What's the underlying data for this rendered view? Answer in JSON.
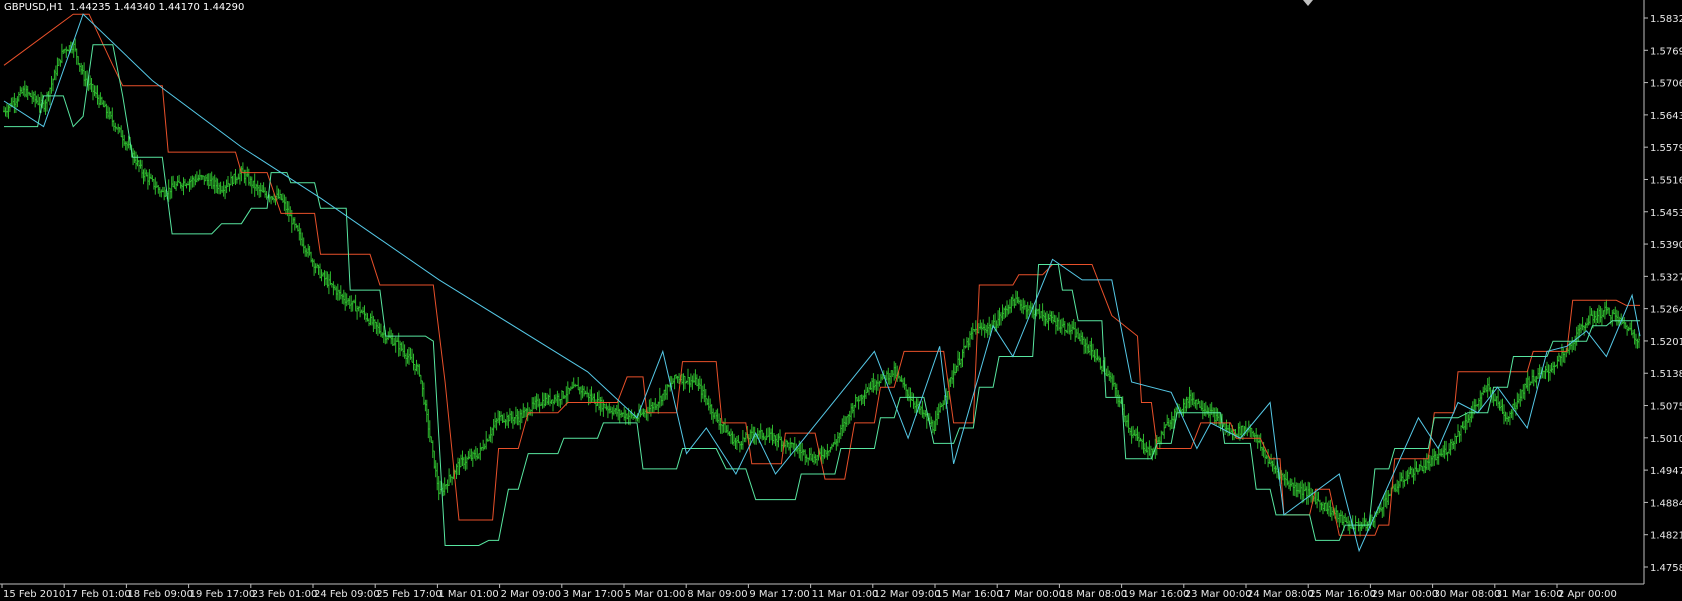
{
  "window": {
    "symbol_timeframe": "GBPUSD,H1",
    "ohlc": "1.44235 1.44340 1.44170 1.44290"
  },
  "colors": {
    "background": "#000000",
    "bars": "#2eb82e",
    "upper_channel": "#e8502a",
    "lower_channel": "#58e6a0",
    "zigzag": "#55c8e6",
    "axis_text": "#e8e8e8",
    "axis_line": "#bfbfbf"
  },
  "chart_data": {
    "type": "line",
    "title": "GBPUSD,H1",
    "price_axis_labels": [
      "1.58325",
      "1.57695",
      "1.57065",
      "1.56435",
      "1.55790",
      "1.55160",
      "1.54530",
      "1.53900",
      "1.53270",
      "1.52640",
      "1.52010",
      "1.51380",
      "1.50755",
      "1.50105",
      "1.49475",
      "1.48845",
      "1.48215",
      "1.47580"
    ],
    "time_axis_labels": [
      "15 Feb 2010",
      "17 Feb 01:00",
      "18 Feb 09:00",
      "19 Feb 17:00",
      "23 Feb 01:00",
      "24 Feb 09:00",
      "25 Feb 17:00",
      "1 Mar 01:00",
      "2 Mar 09:00",
      "3 Mar 17:00",
      "5 Mar 01:00",
      "8 Mar 09:00",
      "9 Mar 17:00",
      "11 Mar 01:00",
      "12 Mar 09:00",
      "15 Mar 16:00",
      "17 Mar 00:00",
      "18 Mar 08:00",
      "19 Mar 16:00",
      "23 Mar 00:00",
      "24 Mar 08:00",
      "25 Mar 16:00",
      "29 Mar 00:00",
      "30 Mar 08:00",
      "31 Mar 16:00",
      "2 Apr 00:00"
    ],
    "ylim": [
      1.4758,
      1.5865
    ],
    "close_path": [
      [
        0,
        1.565
      ],
      [
        1,
        1.569
      ],
      [
        2,
        1.566
      ],
      [
        3,
        1.577
      ],
      [
        3.5,
        1.578
      ],
      [
        4,
        1.572
      ],
      [
        5,
        1.566
      ],
      [
        6,
        1.56
      ],
      [
        7,
        1.553
      ],
      [
        8,
        1.549
      ],
      [
        9,
        1.551
      ],
      [
        10,
        1.552
      ],
      [
        11,
        1.55
      ],
      [
        12,
        1.553
      ],
      [
        13,
        1.549
      ],
      [
        14,
        1.548
      ],
      [
        15,
        1.54
      ],
      [
        16,
        1.533
      ],
      [
        17,
        1.529
      ],
      [
        18,
        1.526
      ],
      [
        19,
        1.522
      ],
      [
        20,
        1.519
      ],
      [
        21,
        1.514
      ],
      [
        22,
        1.49
      ],
      [
        23,
        1.496
      ],
      [
        24,
        1.498
      ],
      [
        25,
        1.505
      ],
      [
        26,
        1.505
      ],
      [
        27,
        1.508
      ],
      [
        28,
        1.509
      ],
      [
        29,
        1.511
      ],
      [
        30,
        1.508
      ],
      [
        31,
        1.506
      ],
      [
        32,
        1.505
      ],
      [
        33,
        1.508
      ],
      [
        34,
        1.513
      ],
      [
        35,
        1.512
      ],
      [
        36,
        1.505
      ],
      [
        37,
        1.5
      ],
      [
        38,
        1.502
      ],
      [
        39,
        1.501
      ],
      [
        40,
        1.499
      ],
      [
        41,
        1.497
      ],
      [
        42,
        1.5
      ],
      [
        43,
        1.508
      ],
      [
        44,
        1.512
      ],
      [
        45,
        1.514
      ],
      [
        46,
        1.508
      ],
      [
        47,
        1.503
      ],
      [
        48,
        1.514
      ],
      [
        49,
        1.522
      ],
      [
        50,
        1.523
      ],
      [
        51,
        1.528
      ],
      [
        52,
        1.526
      ],
      [
        53,
        1.524
      ],
      [
        54,
        1.522
      ],
      [
        55,
        1.518
      ],
      [
        56,
        1.512
      ],
      [
        57,
        1.502
      ],
      [
        58,
        1.498
      ],
      [
        59,
        1.505
      ],
      [
        60,
        1.509
      ],
      [
        61,
        1.506
      ],
      [
        62,
        1.502
      ],
      [
        63,
        1.503
      ],
      [
        64,
        1.496
      ],
      [
        65,
        1.492
      ],
      [
        66,
        1.49
      ],
      [
        67,
        1.487
      ],
      [
        68,
        1.484
      ],
      [
        69,
        1.484
      ],
      [
        70,
        1.49
      ],
      [
        71,
        1.494
      ],
      [
        72,
        1.496
      ],
      [
        73,
        1.499
      ],
      [
        74,
        1.505
      ],
      [
        75,
        1.511
      ],
      [
        76,
        1.505
      ],
      [
        77,
        1.512
      ],
      [
        78,
        1.514
      ],
      [
        79,
        1.518
      ],
      [
        80,
        1.524
      ],
      [
        81,
        1.526
      ],
      [
        82,
        1.523
      ],
      [
        82.7,
        1.52
      ]
    ],
    "upper_channel": [
      [
        0,
        1.574
      ],
      [
        3.5,
        1.584
      ],
      [
        4.3,
        1.584
      ],
      [
        5.5,
        1.574
      ],
      [
        6,
        1.57
      ],
      [
        8,
        1.57
      ],
      [
        8.3,
        1.557
      ],
      [
        11.7,
        1.557
      ],
      [
        12,
        1.553
      ],
      [
        13.3,
        1.553
      ],
      [
        14,
        1.545
      ],
      [
        15.7,
        1.545
      ],
      [
        16,
        1.537
      ],
      [
        18.5,
        1.537
      ],
      [
        19,
        1.531
      ],
      [
        21.7,
        1.531
      ],
      [
        22.3,
        1.512
      ],
      [
        23,
        1.485
      ],
      [
        24.7,
        1.485
      ],
      [
        25,
        1.499
      ],
      [
        26,
        1.499
      ],
      [
        26.5,
        1.506
      ],
      [
        28,
        1.506
      ],
      [
        28.5,
        1.508
      ],
      [
        31,
        1.508
      ],
      [
        31.5,
        1.513
      ],
      [
        32.3,
        1.513
      ],
      [
        32.5,
        1.506
      ],
      [
        34,
        1.506
      ],
      [
        34.3,
        1.516
      ],
      [
        36,
        1.516
      ],
      [
        36.3,
        1.504
      ],
      [
        37.5,
        1.504
      ],
      [
        37.8,
        1.496
      ],
      [
        39.3,
        1.496
      ],
      [
        39.5,
        1.502
      ],
      [
        41,
        1.502
      ],
      [
        41.5,
        1.493
      ],
      [
        42.5,
        1.493
      ],
      [
        43,
        1.504
      ],
      [
        44,
        1.504
      ],
      [
        44.3,
        1.511
      ],
      [
        45,
        1.511
      ],
      [
        45.5,
        1.518
      ],
      [
        47.5,
        1.518
      ],
      [
        48,
        1.504
      ],
      [
        49,
        1.504
      ],
      [
        49.3,
        1.531
      ],
      [
        51,
        1.531
      ],
      [
        51.3,
        1.533
      ],
      [
        52.5,
        1.533
      ],
      [
        53,
        1.535
      ],
      [
        55,
        1.535
      ],
      [
        55.5,
        1.53
      ],
      [
        56,
        1.525
      ],
      [
        57.3,
        1.521
      ],
      [
        57.5,
        1.508
      ],
      [
        58,
        1.508
      ],
      [
        58.3,
        1.499
      ],
      [
        60,
        1.499
      ],
      [
        60.5,
        1.504
      ],
      [
        62,
        1.504
      ],
      [
        62.3,
        1.501
      ],
      [
        63.5,
        1.501
      ],
      [
        64,
        1.497
      ],
      [
        64.5,
        1.497
      ],
      [
        64.7,
        1.486
      ],
      [
        66,
        1.486
      ],
      [
        66.3,
        1.491
      ],
      [
        67,
        1.491
      ],
      [
        67.5,
        1.482
      ],
      [
        69.3,
        1.482
      ],
      [
        69.5,
        1.484
      ],
      [
        70,
        1.484
      ],
      [
        70.3,
        1.497
      ],
      [
        72,
        1.497
      ],
      [
        72.3,
        1.506
      ],
      [
        73.3,
        1.506
      ],
      [
        73.5,
        1.514
      ],
      [
        77,
        1.514
      ],
      [
        77.3,
        1.518
      ],
      [
        79,
        1.518
      ],
      [
        79.3,
        1.528
      ],
      [
        81.5,
        1.528
      ],
      [
        82,
        1.527
      ],
      [
        82.7,
        1.527
      ]
    ],
    "lower_channel": [
      [
        0,
        1.562
      ],
      [
        1.7,
        1.562
      ],
      [
        2,
        1.568
      ],
      [
        3,
        1.568
      ],
      [
        3.5,
        1.562
      ],
      [
        4,
        1.564
      ],
      [
        4.5,
        1.578
      ],
      [
        5.5,
        1.578
      ],
      [
        6,
        1.568
      ],
      [
        6.5,
        1.556
      ],
      [
        8,
        1.556
      ],
      [
        8.5,
        1.541
      ],
      [
        10.5,
        1.541
      ],
      [
        11,
        1.543
      ],
      [
        12,
        1.543
      ],
      [
        12.5,
        1.546
      ],
      [
        13.3,
        1.546
      ],
      [
        13.5,
        1.553
      ],
      [
        14.3,
        1.553
      ],
      [
        14.5,
        1.551
      ],
      [
        15.7,
        1.551
      ],
      [
        16,
        1.546
      ],
      [
        17.3,
        1.546
      ],
      [
        17.5,
        1.53
      ],
      [
        19,
        1.53
      ],
      [
        19.3,
        1.521
      ],
      [
        21.3,
        1.521
      ],
      [
        21.7,
        1.52
      ],
      [
        22.3,
        1.48
      ],
      [
        24,
        1.48
      ],
      [
        24.5,
        1.481
      ],
      [
        25,
        1.481
      ],
      [
        25.5,
        1.491
      ],
      [
        26,
        1.491
      ],
      [
        26.5,
        1.498
      ],
      [
        28,
        1.498
      ],
      [
        28.3,
        1.501
      ],
      [
        30,
        1.501
      ],
      [
        30.3,
        1.504
      ],
      [
        32,
        1.504
      ],
      [
        32.3,
        1.495
      ],
      [
        34,
        1.495
      ],
      [
        34.3,
        1.499
      ],
      [
        36,
        1.499
      ],
      [
        36.5,
        1.495
      ],
      [
        37.5,
        1.495
      ],
      [
        38,
        1.489
      ],
      [
        40,
        1.489
      ],
      [
        40.3,
        1.494
      ],
      [
        42,
        1.494
      ],
      [
        42.3,
        1.499
      ],
      [
        44,
        1.499
      ],
      [
        44.3,
        1.505
      ],
      [
        45,
        1.505
      ],
      [
        45.3,
        1.509
      ],
      [
        46.5,
        1.509
      ],
      [
        47,
        1.5
      ],
      [
        48,
        1.5
      ],
      [
        48.3,
        1.503
      ],
      [
        49,
        1.503
      ],
      [
        49.3,
        1.511
      ],
      [
        50,
        1.511
      ],
      [
        50.3,
        1.517
      ],
      [
        52,
        1.517
      ],
      [
        52.3,
        1.535
      ],
      [
        53.3,
        1.535
      ],
      [
        53.5,
        1.53
      ],
      [
        54,
        1.53
      ],
      [
        54.3,
        1.524
      ],
      [
        55.5,
        1.524
      ],
      [
        55.7,
        1.509
      ],
      [
        56.5,
        1.509
      ],
      [
        56.7,
        1.497
      ],
      [
        58,
        1.497
      ],
      [
        58.3,
        1.5
      ],
      [
        59,
        1.5
      ],
      [
        59.3,
        1.506
      ],
      [
        61.5,
        1.506
      ],
      [
        61.7,
        1.5
      ],
      [
        63,
        1.5
      ],
      [
        63.3,
        1.491
      ],
      [
        64,
        1.491
      ],
      [
        64.3,
        1.486
      ],
      [
        66,
        1.486
      ],
      [
        66.3,
        1.481
      ],
      [
        67.5,
        1.481
      ],
      [
        67.8,
        1.484
      ],
      [
        69,
        1.484
      ],
      [
        69.3,
        1.495
      ],
      [
        70,
        1.495
      ],
      [
        70.3,
        1.499
      ],
      [
        72,
        1.499
      ],
      [
        72.3,
        1.505
      ],
      [
        73.5,
        1.505
      ],
      [
        74,
        1.506
      ],
      [
        75,
        1.506
      ],
      [
        75.3,
        1.511
      ],
      [
        76,
        1.511
      ],
      [
        76.3,
        1.517
      ],
      [
        78,
        1.517
      ],
      [
        78.3,
        1.52
      ],
      [
        80,
        1.52
      ],
      [
        80.3,
        1.523
      ],
      [
        81,
        1.523
      ],
      [
        81.3,
        1.524
      ],
      [
        82.7,
        1.524
      ]
    ],
    "zigzag": [
      [
        0,
        1.567
      ],
      [
        2,
        1.562
      ],
      [
        3,
        1.573
      ],
      [
        4,
        1.584
      ],
      [
        7.5,
        1.571
      ],
      [
        12,
        1.558
      ],
      [
        16,
        1.548
      ],
      [
        22,
        1.532
      ],
      [
        29.5,
        1.514
      ],
      [
        32,
        1.505
      ],
      [
        33.3,
        1.518
      ],
      [
        34.5,
        1.498
      ],
      [
        35.5,
        1.503
      ],
      [
        37,
        1.494
      ],
      [
        38,
        1.502
      ],
      [
        39,
        1.494
      ],
      [
        44,
        1.518
      ],
      [
        45.7,
        1.501
      ],
      [
        47.3,
        1.519
      ],
      [
        48,
        1.496
      ],
      [
        50,
        1.523
      ],
      [
        51,
        1.517
      ],
      [
        53,
        1.536
      ],
      [
        54.5,
        1.532
      ],
      [
        56,
        1.532
      ],
      [
        57,
        1.512
      ],
      [
        59,
        1.51
      ],
      [
        60.3,
        1.499
      ],
      [
        61,
        1.504
      ],
      [
        62.5,
        1.501
      ],
      [
        64,
        1.508
      ],
      [
        64.7,
        1.486
      ],
      [
        67.5,
        1.494
      ],
      [
        68.5,
        1.479
      ],
      [
        71.5,
        1.505
      ],
      [
        72.5,
        1.499
      ],
      [
        73.5,
        1.508
      ],
      [
        74.5,
        1.506
      ],
      [
        75.5,
        1.511
      ],
      [
        77,
        1.503
      ],
      [
        78,
        1.518
      ],
      [
        79,
        1.519
      ],
      [
        80,
        1.522
      ],
      [
        81,
        1.517
      ],
      [
        82.3,
        1.529
      ],
      [
        82.7,
        1.521
      ]
    ]
  }
}
